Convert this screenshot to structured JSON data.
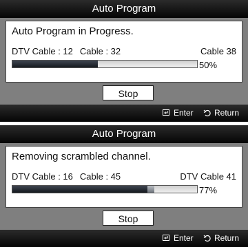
{
  "screens": [
    {
      "title": "Auto Program",
      "message": "Auto Program in Progress.",
      "dtv_cable_text": "DTV Cable : 12",
      "cable_text": "Cable : 32",
      "current_channel": "Cable 38",
      "percent_text": "50%",
      "progress": 0.5,
      "stop_label": "Stop",
      "enter_label": "Enter",
      "return_label": "Return",
      "enter_icon": "enter-icon",
      "return_icon": "return-icon"
    },
    {
      "title": "Auto Program",
      "message": "Removing scrambled channel.",
      "dtv_cable_text": "DTV Cable : 16",
      "cable_text": "Cable : 45",
      "current_channel": "DTV Cable 41",
      "percent_text": "77%",
      "progress": 0.77,
      "stop_label": "Stop",
      "enter_label": "Enter",
      "return_label": "Return",
      "enter_icon": "enter-icon",
      "return_icon": "return-icon"
    }
  ],
  "colors": {
    "panel_background": "#7f7f7f",
    "bar_dark": "#050505",
    "progress_fill": "#15191f",
    "progress_marker": "#8a9098"
  }
}
